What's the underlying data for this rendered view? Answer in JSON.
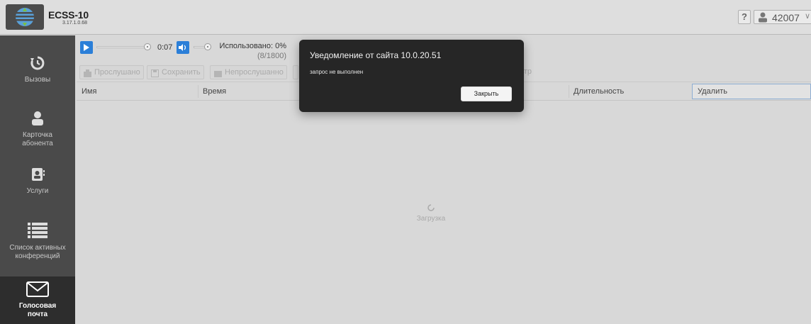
{
  "header": {
    "title": "ECSS-10",
    "version": "3.17.1.0.68",
    "help_label": "?",
    "user_number": "42007",
    "caret": "∨"
  },
  "sidebar": {
    "items": [
      {
        "label": "Вызовы",
        "icon": "history-icon"
      },
      {
        "label": "Карточка абонента",
        "icon": "person-icon"
      },
      {
        "label": "Услуги",
        "icon": "contact-card-icon"
      },
      {
        "label": "Список активных конференций",
        "icon": "list-icon"
      },
      {
        "label": "Голосовая почта",
        "icon": "envelope-icon",
        "active": true
      }
    ]
  },
  "player": {
    "time": "0:07",
    "used_label": "Использовано: 0%",
    "used_count": "(8/1800)"
  },
  "toolbar": {
    "listened": "Прослушано",
    "save": "Сохранить",
    "unlistened": "Непрослушанно",
    "filter_partial": "ьтр"
  },
  "table": {
    "columns": [
      "Имя",
      "Время",
      "Длительность",
      "Удалить"
    ]
  },
  "loading": {
    "label": "Загрузка"
  },
  "dialog": {
    "title": "Уведомление от сайта 10.0.20.51",
    "message": "запрос не выполнен",
    "close_label": "Закрыть"
  },
  "colors": {
    "accent": "#2b7fd8",
    "sidebar_bg": "#4a4a4a",
    "sidebar_active": "#2d2d2d",
    "dialog_bg": "#262626"
  }
}
